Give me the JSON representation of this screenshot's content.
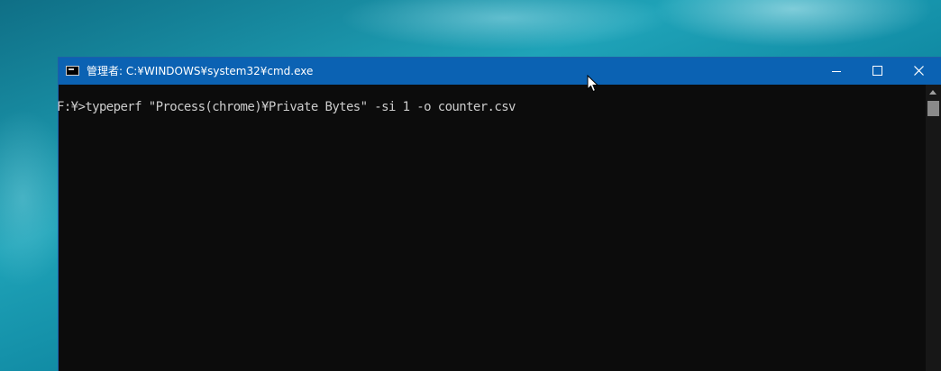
{
  "window": {
    "title": "管理者: C:¥WINDOWS¥system32¥cmd.exe",
    "titlebar_color": "#0b62b3",
    "app_icon": "console-icon",
    "controls": [
      "minimize-icon",
      "maximize-icon",
      "close-icon"
    ]
  },
  "console": {
    "lines": [
      "F:¥>typeperf \"Process(chrome)¥Private Bytes\" -si 1 -o counter.csv"
    ],
    "background": "#0c0c0c",
    "text_color": "#cccccc"
  },
  "scrollbar": {
    "icon": "scroll-up-arrow-icon"
  },
  "pointer": {
    "icon": "mouse-pointer-icon"
  }
}
